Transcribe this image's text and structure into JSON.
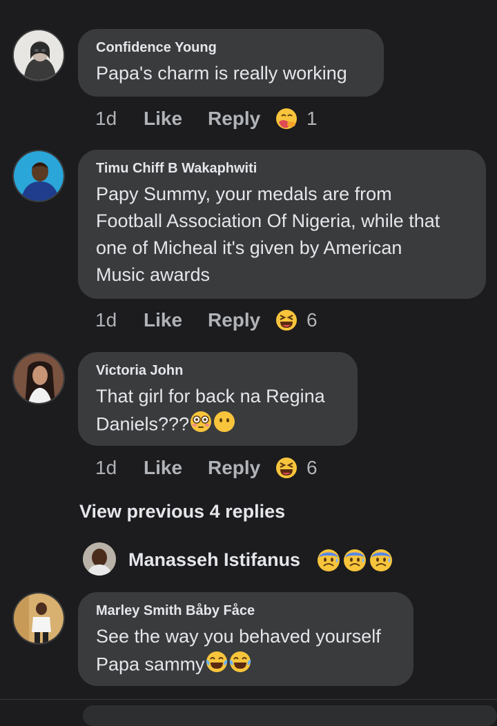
{
  "comments": [
    {
      "author": "Confidence Young",
      "text_lines": [
        "Papa's charm is really working"
      ],
      "time": "1d",
      "like_label": "Like",
      "reply_label": "Reply",
      "reaction_icon": "care-hug-emoji",
      "reaction_count": "1"
    },
    {
      "author": "Timu Chiff B Wakaphwiti",
      "text_lines": [
        "Papy Summy, your medals are from",
        "Football Association Of Nigeria, while that",
        "one of Micheal it's given by American",
        "Music awards"
      ],
      "time": "1d",
      "like_label": "Like",
      "reply_label": "Reply",
      "reaction_icon": "laughing-squint-emoji",
      "reaction_count": "6"
    },
    {
      "author": "Victoria John",
      "text_lines": [
        "That girl for back na Regina",
        "Daniels???"
      ],
      "time": "1d",
      "like_label": "Like",
      "reply_label": "Reply",
      "reaction_icon": "laughing-squint-emoji",
      "reaction_count": "6"
    },
    {
      "author": "Marley Smith Båby Fåce",
      "text_lines": [
        "See the way you behaved yourself",
        "Papa sammy"
      ]
    }
  ],
  "view_previous": "View previous 4 replies",
  "reply_preview": {
    "author": "Manasseh Istifanus",
    "emoji_icons": [
      "anxious-sweat-emoji",
      "anxious-sweat-emoji",
      "anxious-sweat-emoji"
    ]
  }
}
